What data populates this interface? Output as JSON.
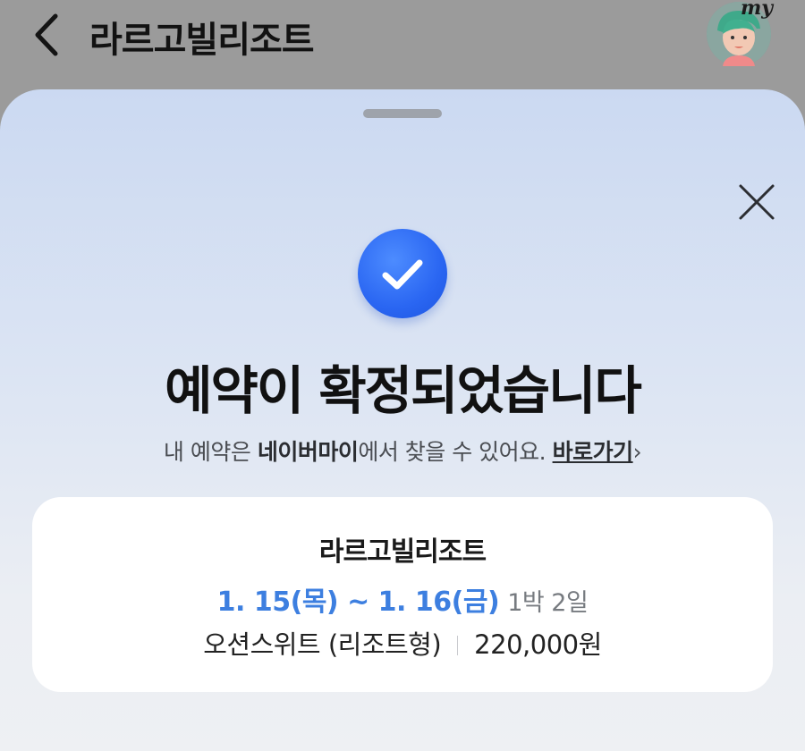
{
  "header": {
    "title": "라르고빌리조트",
    "avatar_tag": "my"
  },
  "sheet": {
    "headline": "예약이 확정되었습니다",
    "sub_prefix": "내 예약은 ",
    "sub_brand": "네이버마이",
    "sub_suffix": "에서 찾을 수 있어요. ",
    "goto_link": "바로가기",
    "goto_chevron": "›"
  },
  "booking": {
    "property": "라르고빌리조트",
    "dates": "1. 15(목) ~ 1. 16(금)",
    "nights": "1박 2일",
    "room": "오션스위트 (리조트형)",
    "price": "220,000원"
  },
  "colors": {
    "accent": "#3d7fe0",
    "check_badge": "#2a66f2",
    "overlay": "#9b9b9b"
  }
}
